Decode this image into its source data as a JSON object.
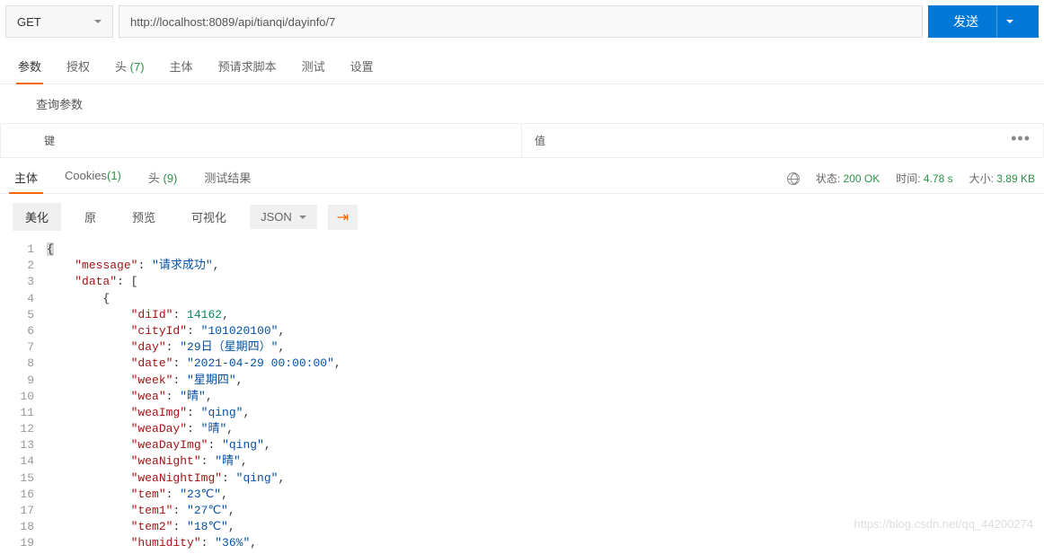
{
  "request": {
    "method": "GET",
    "url": "http://localhost:8089/api/tianqi/dayinfo/7",
    "send_label": "发送"
  },
  "req_tabs": {
    "items": [
      {
        "label": "参数",
        "active": true
      },
      {
        "label": "授权"
      },
      {
        "label_prefix": "头",
        "count": "(7)"
      },
      {
        "label": "主体"
      },
      {
        "label": "预请求脚本"
      },
      {
        "label": "测试"
      },
      {
        "label": "设置"
      }
    ]
  },
  "query_params": {
    "title": "查询参数",
    "key_header": "键",
    "value_header": "值"
  },
  "resp_tabs": {
    "items": [
      {
        "label": "主体",
        "active": true
      },
      {
        "label": "Cookies",
        "count": "(1)"
      },
      {
        "label_prefix": "头",
        "count": "(9)"
      },
      {
        "label": "测试结果"
      }
    ]
  },
  "resp_meta": {
    "status_label": "状态:",
    "status_value": "200 OK",
    "time_label": "时间:",
    "time_value": "4.78 s",
    "size_label": "大小:",
    "size_value": "3.89 KB"
  },
  "view_toolbar": {
    "pretty": "美化",
    "raw": "原",
    "preview": "预览",
    "visualize": "可视化",
    "format": "JSON"
  },
  "code_lines": [
    [
      {
        "t": "pun",
        "v": "{"
      }
    ],
    [
      {
        "indent": 1
      },
      {
        "t": "key",
        "v": "\"message\""
      },
      {
        "t": "pun",
        "v": ": "
      },
      {
        "t": "str",
        "v": "\"请求成功\""
      },
      {
        "t": "pun",
        "v": ","
      }
    ],
    [
      {
        "indent": 1
      },
      {
        "t": "key",
        "v": "\"data\""
      },
      {
        "t": "pun",
        "v": ": ["
      }
    ],
    [
      {
        "indent": 2
      },
      {
        "t": "pun",
        "v": "{"
      }
    ],
    [
      {
        "indent": 3
      },
      {
        "t": "key",
        "v": "\"diId\""
      },
      {
        "t": "pun",
        "v": ": "
      },
      {
        "t": "num",
        "v": "14162"
      },
      {
        "t": "pun",
        "v": ","
      }
    ],
    [
      {
        "indent": 3
      },
      {
        "t": "key",
        "v": "\"cityId\""
      },
      {
        "t": "pun",
        "v": ": "
      },
      {
        "t": "str",
        "v": "\"101020100\""
      },
      {
        "t": "pun",
        "v": ","
      }
    ],
    [
      {
        "indent": 3
      },
      {
        "t": "key",
        "v": "\"day\""
      },
      {
        "t": "pun",
        "v": ": "
      },
      {
        "t": "str",
        "v": "\"29日（星期四）\""
      },
      {
        "t": "pun",
        "v": ","
      }
    ],
    [
      {
        "indent": 3
      },
      {
        "t": "key",
        "v": "\"date\""
      },
      {
        "t": "pun",
        "v": ": "
      },
      {
        "t": "str",
        "v": "\"2021-04-29 00:00:00\""
      },
      {
        "t": "pun",
        "v": ","
      }
    ],
    [
      {
        "indent": 3
      },
      {
        "t": "key",
        "v": "\"week\""
      },
      {
        "t": "pun",
        "v": ": "
      },
      {
        "t": "str",
        "v": "\"星期四\""
      },
      {
        "t": "pun",
        "v": ","
      }
    ],
    [
      {
        "indent": 3
      },
      {
        "t": "key",
        "v": "\"wea\""
      },
      {
        "t": "pun",
        "v": ": "
      },
      {
        "t": "str",
        "v": "\"晴\""
      },
      {
        "t": "pun",
        "v": ","
      }
    ],
    [
      {
        "indent": 3
      },
      {
        "t": "key",
        "v": "\"weaImg\""
      },
      {
        "t": "pun",
        "v": ": "
      },
      {
        "t": "str",
        "v": "\"qing\""
      },
      {
        "t": "pun",
        "v": ","
      }
    ],
    [
      {
        "indent": 3
      },
      {
        "t": "key",
        "v": "\"weaDay\""
      },
      {
        "t": "pun",
        "v": ": "
      },
      {
        "t": "str",
        "v": "\"晴\""
      },
      {
        "t": "pun",
        "v": ","
      }
    ],
    [
      {
        "indent": 3
      },
      {
        "t": "key",
        "v": "\"weaDayImg\""
      },
      {
        "t": "pun",
        "v": ": "
      },
      {
        "t": "str",
        "v": "\"qing\""
      },
      {
        "t": "pun",
        "v": ","
      }
    ],
    [
      {
        "indent": 3
      },
      {
        "t": "key",
        "v": "\"weaNight\""
      },
      {
        "t": "pun",
        "v": ": "
      },
      {
        "t": "str",
        "v": "\"晴\""
      },
      {
        "t": "pun",
        "v": ","
      }
    ],
    [
      {
        "indent": 3
      },
      {
        "t": "key",
        "v": "\"weaNightImg\""
      },
      {
        "t": "pun",
        "v": ": "
      },
      {
        "t": "str",
        "v": "\"qing\""
      },
      {
        "t": "pun",
        "v": ","
      }
    ],
    [
      {
        "indent": 3
      },
      {
        "t": "key",
        "v": "\"tem\""
      },
      {
        "t": "pun",
        "v": ": "
      },
      {
        "t": "str",
        "v": "\"23℃\""
      },
      {
        "t": "pun",
        "v": ","
      }
    ],
    [
      {
        "indent": 3
      },
      {
        "t": "key",
        "v": "\"tem1\""
      },
      {
        "t": "pun",
        "v": ": "
      },
      {
        "t": "str",
        "v": "\"27℃\""
      },
      {
        "t": "pun",
        "v": ","
      }
    ],
    [
      {
        "indent": 3
      },
      {
        "t": "key",
        "v": "\"tem2\""
      },
      {
        "t": "pun",
        "v": ": "
      },
      {
        "t": "str",
        "v": "\"18℃\""
      },
      {
        "t": "pun",
        "v": ","
      }
    ],
    [
      {
        "indent": 3
      },
      {
        "t": "key",
        "v": "\"humidity\""
      },
      {
        "t": "pun",
        "v": ": "
      },
      {
        "t": "str",
        "v": "\"36%\""
      },
      {
        "t": "pun",
        "v": ","
      }
    ]
  ],
  "watermark": "https://blog.csdn.net/qq_44200274"
}
